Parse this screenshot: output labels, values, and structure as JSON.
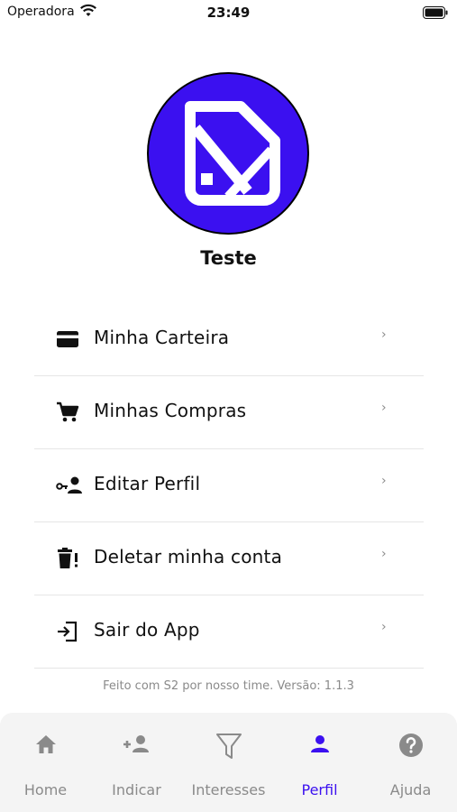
{
  "status_bar": {
    "carrier": "Operadora",
    "time": "23:49"
  },
  "profile": {
    "name": "Teste"
  },
  "menu": {
    "items": [
      {
        "label": "Minha Carteira",
        "icon": "wallet-icon"
      },
      {
        "label": "Minhas Compras",
        "icon": "cart-icon"
      },
      {
        "label": "Editar Perfil",
        "icon": "user-key-icon"
      },
      {
        "label": "Deletar minha conta",
        "icon": "trash-alert-icon"
      },
      {
        "label": "Sair do App",
        "icon": "logout-icon"
      }
    ],
    "chevron": "›"
  },
  "footer": {
    "text": "Feito com S2 por nosso time. Versão: 1.1.3"
  },
  "tabbar": {
    "tabs": [
      {
        "label": "Home",
        "icon": "home-icon"
      },
      {
        "label": "Indicar",
        "icon": "add-person-icon"
      },
      {
        "label": "Interesses",
        "icon": "filter-icon"
      },
      {
        "label": "Perfil",
        "icon": "person-icon",
        "active": true
      },
      {
        "label": "Ajuda",
        "icon": "help-icon"
      }
    ]
  },
  "colors": {
    "accent": "#3b10f0",
    "inactive": "#8a8a8a",
    "tabbar_bg": "#f4f4f4",
    "divider": "#e6e6e6"
  }
}
